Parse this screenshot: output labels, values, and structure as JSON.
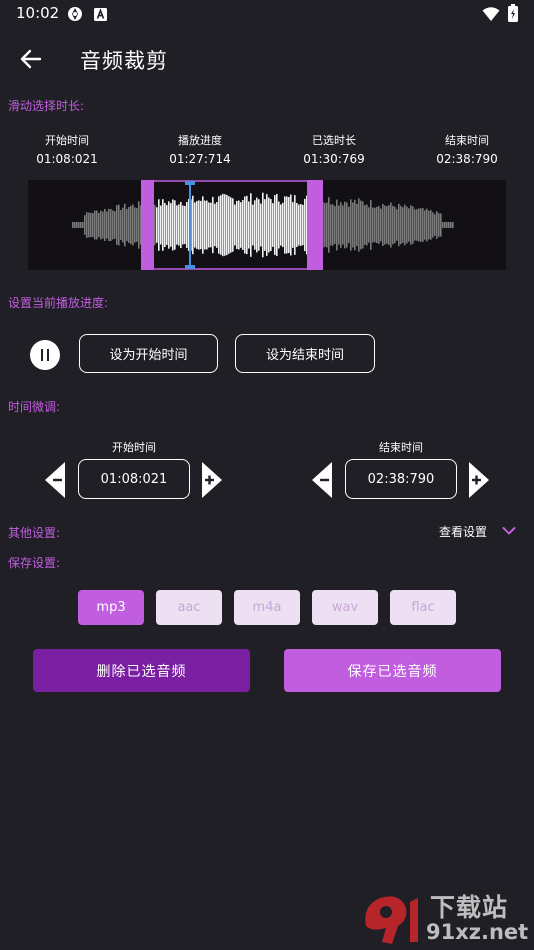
{
  "status_bar": {
    "time": "10:02"
  },
  "app_bar": {
    "title": "音频裁剪"
  },
  "sections": {
    "slide_select": "滑动选择时长:",
    "set_progress": "设置当前播放进度:",
    "fine_tune": "时间微调:",
    "other_settings": "其他设置:",
    "save_settings": "保存设置:"
  },
  "time_info": [
    {
      "label": "开始时间",
      "value": "01:08:021"
    },
    {
      "label": "播放进度",
      "value": "01:27:714"
    },
    {
      "label": "已选时长",
      "value": "01:30:769"
    },
    {
      "label": "结束时间",
      "value": "02:38:790"
    }
  ],
  "waveform": {
    "selection_start_fraction": 0.24,
    "selection_end_fraction": 0.62,
    "playhead_fraction": 0.33
  },
  "progress_buttons": {
    "set_start": "设为开始时间",
    "set_end": "设为结束时间"
  },
  "fine_tune": {
    "start_label": "开始时间",
    "start_value": "01:08:021",
    "end_label": "结束时间",
    "end_value": "02:38:790"
  },
  "other": {
    "view_settings": "查看设置"
  },
  "formats": [
    {
      "label": "mp3",
      "selected": true
    },
    {
      "label": "aac",
      "selected": false
    },
    {
      "label": "m4a",
      "selected": false
    },
    {
      "label": "wav",
      "selected": false
    },
    {
      "label": "flac",
      "selected": false
    }
  ],
  "actions": {
    "delete": "删除已选音频",
    "save": "保存已选音频"
  },
  "watermark": {
    "text": "91xz.net",
    "text_cn": "下载站"
  },
  "colors": {
    "background": "#211f26",
    "accent": "#c15ee0",
    "delete_button": "#7b1fa2",
    "chip_inactive": "#ece0f2",
    "playhead": "#4a90e2"
  }
}
